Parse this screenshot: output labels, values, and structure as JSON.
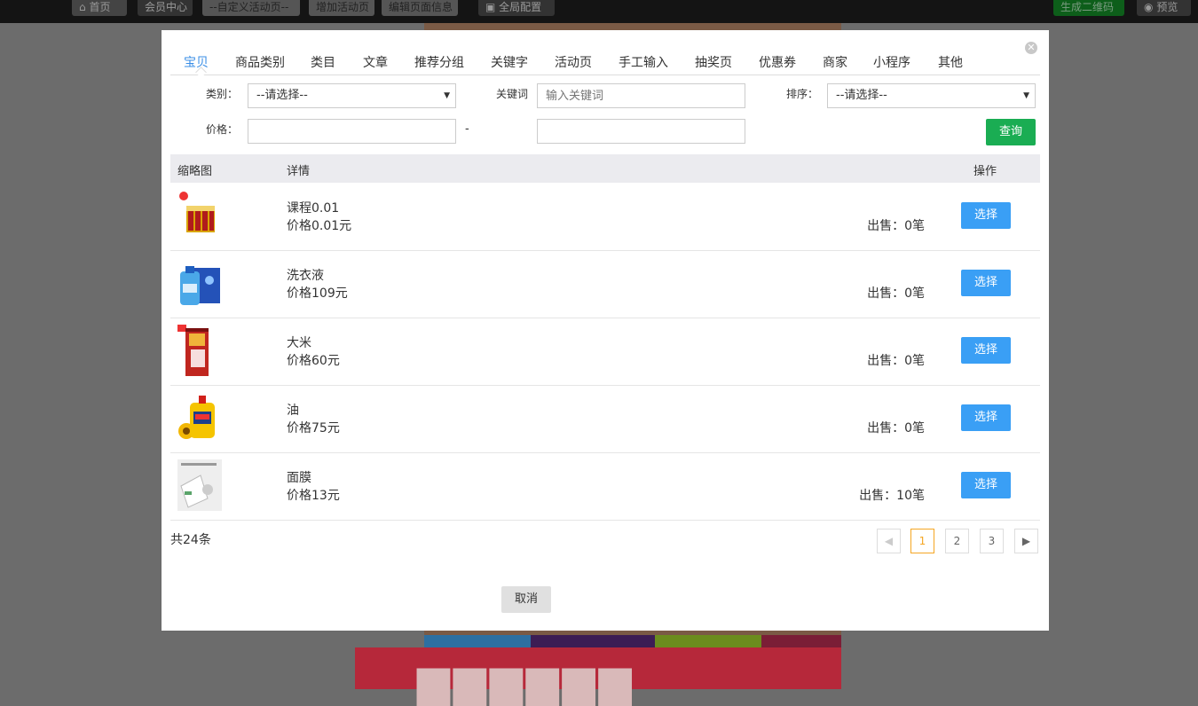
{
  "background": {
    "topbar": {
      "home_label": "首页",
      "member_center_label": "会员中心",
      "custom_activity_select": "--自定义活动页--",
      "add_activity_label": "增加活动页",
      "edit_page_info_label": "编辑页面信息",
      "global_config_label": "全局配置",
      "generate_qr_label": "生成二维码",
      "preview_label": "预览"
    }
  },
  "modal": {
    "tabs": [
      "宝贝",
      "商品类别",
      "类目",
      "文章",
      "推荐分组",
      "关键字",
      "活动页",
      "手工输入",
      "抽奖页",
      "优惠券",
      "商家",
      "小程序",
      "其他"
    ],
    "active_tab": "宝贝",
    "filters": {
      "category_label": "类别：",
      "category_value": "--请选择--",
      "keyword_label": "关键词",
      "keyword_placeholder": "输入关键词",
      "sort_label": "排序：",
      "sort_value": "--请选择--",
      "price_label": "价格：",
      "price_separator": "-",
      "query_button": "查询"
    },
    "table": {
      "headers": {
        "thumbnail": "缩略图",
        "detail": "详情",
        "action": "操作"
      },
      "rows": [
        {
          "name": "课程0.01",
          "price": "价格0.01元",
          "sold": "出售：0笔",
          "action": "选择",
          "thumb": "drink-box-icon"
        },
        {
          "name": "洗衣液",
          "price": "价格109元",
          "sold": "出售：0笔",
          "action": "选择",
          "thumb": "detergent-bottle-icon"
        },
        {
          "name": "大米",
          "price": "价格60元",
          "sold": "出售：0笔",
          "action": "选择",
          "thumb": "rice-bag-icon"
        },
        {
          "name": "油",
          "price": "价格75元",
          "sold": "出售：0笔",
          "action": "选择",
          "thumb": "oil-bottle-icon"
        },
        {
          "name": "面膜",
          "price": "价格13元",
          "sold": "出售：10笔",
          "action": "选择",
          "thumb": "face-mask-icon"
        }
      ]
    },
    "pagination": {
      "total": "共24条",
      "pages": [
        "1",
        "2",
        "3"
      ],
      "current": "1"
    },
    "cancel_button": "取消"
  },
  "colors": {
    "accent": "#3a9ff5",
    "query": "#1aad53",
    "active_page": "#f5a623",
    "active_tab": "#3a8ee6"
  }
}
